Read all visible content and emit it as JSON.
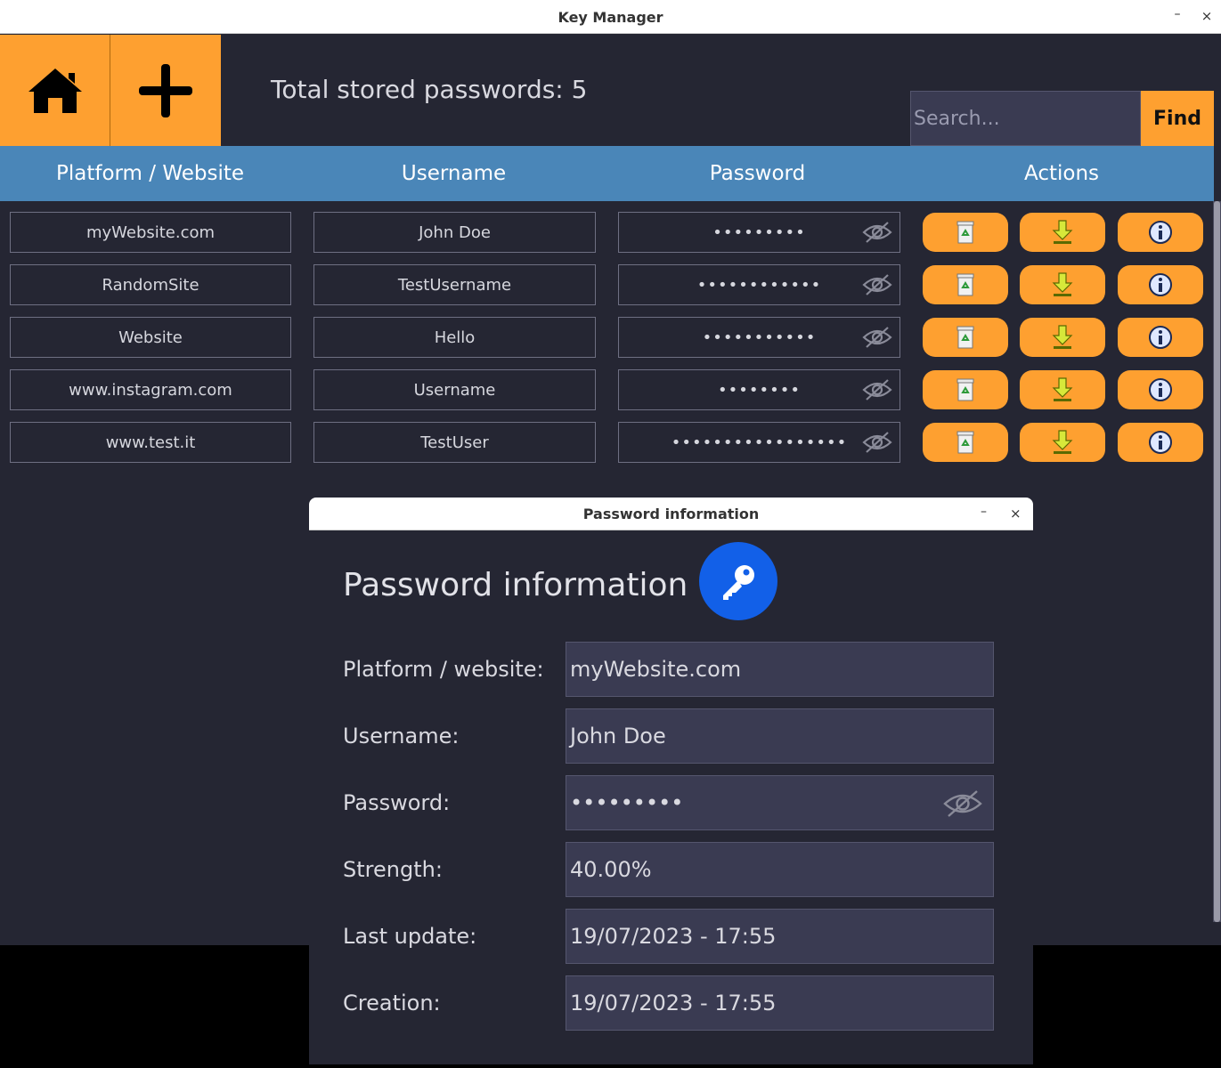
{
  "window": {
    "title": "Key Manager",
    "min_glyph": "–",
    "close_glyph": "×"
  },
  "nav": {
    "home_icon": "home-icon",
    "add_icon": "plus-icon"
  },
  "summary": {
    "total_text": "Total stored passwords: 5"
  },
  "search": {
    "placeholder": "Search...",
    "find_label": "Find"
  },
  "table": {
    "headers": [
      "Platform / Website",
      "Username",
      "Password",
      "Actions"
    ],
    "rows": [
      {
        "platform": "myWebsite.com",
        "username": "John Doe",
        "password_mask": "•••••••••"
      },
      {
        "platform": "RandomSite",
        "username": "TestUsername",
        "password_mask": "••••••••••••"
      },
      {
        "platform": "Website",
        "username": "Hello",
        "password_mask": "•••••••••••"
      },
      {
        "platform": "www.instagram.com",
        "username": "Username",
        "password_mask": "••••••••"
      },
      {
        "platform": "www.test.it",
        "username": "TestUser",
        "password_mask": "•••••••••••••••••"
      }
    ],
    "action_icons": [
      "recycle-bin-icon",
      "download-arrow-icon",
      "info-icon"
    ]
  },
  "colors": {
    "accent": "#fea030",
    "header": "#4a86b8",
    "background": "#252633",
    "field": "#3a3b52",
    "key_badge": "#1260e8"
  },
  "dialog": {
    "title": "Password information",
    "heading": "Password information",
    "min_glyph": "–",
    "close_glyph": "×",
    "fields": [
      {
        "label": "Platform / website:",
        "value": "myWebsite.com"
      },
      {
        "label": "Username:",
        "value": "John Doe"
      },
      {
        "label": "Password:",
        "value": "•••••••••"
      },
      {
        "label": "Strength:",
        "value": "40.00%"
      },
      {
        "label": "Last update:",
        "value": "19/07/2023 - 17:55"
      },
      {
        "label": "Creation:",
        "value": "19/07/2023 - 17:55"
      }
    ]
  }
}
